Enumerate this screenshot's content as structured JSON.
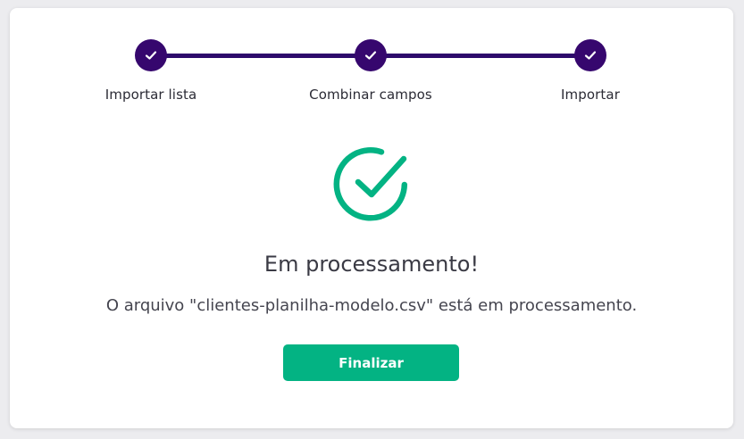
{
  "stepper": {
    "steps": [
      {
        "label": "Importar lista",
        "status": "completed",
        "icon": "check-icon"
      },
      {
        "label": "Combinar campos",
        "status": "completed",
        "icon": "check-icon"
      },
      {
        "label": "Importar",
        "status": "completed",
        "icon": "check-icon"
      }
    ]
  },
  "result": {
    "icon": "check-circle-icon",
    "title": "Em processamento!",
    "message": "O arquivo \"clientes-planilha-modelo.csv\" está em processamento."
  },
  "actions": {
    "finish_label": "Finalizar"
  },
  "colors": {
    "step_color": "#36076e",
    "success_color": "#03b383",
    "text_color": "#3a3a44"
  }
}
